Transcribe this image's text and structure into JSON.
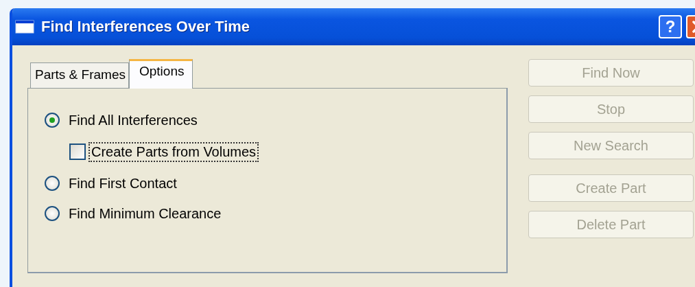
{
  "window": {
    "title": "Find Interferences Over Time",
    "help": "?"
  },
  "tabs": [
    {
      "label": "Parts & Frames",
      "selected": false
    },
    {
      "label": "Options",
      "selected": true
    }
  ],
  "options": [
    {
      "kind": "radio",
      "label": "Find All Interferences",
      "checked": true,
      "focused": false
    },
    {
      "kind": "checkbox",
      "label": "Create Parts from Volumes",
      "checked": false,
      "focused": true
    },
    {
      "kind": "radio",
      "label": "Find First Contact",
      "checked": false,
      "focused": false
    },
    {
      "kind": "radio",
      "label": "Find Minimum Clearance",
      "checked": false,
      "focused": false
    }
  ],
  "button_groups": [
    [
      {
        "label": "Find Now",
        "disabled": true
      },
      {
        "label": "Stop",
        "disabled": true
      },
      {
        "label": "New Search",
        "disabled": true
      }
    ],
    [
      {
        "label": "Create Part",
        "disabled": true
      },
      {
        "label": "Delete Part",
        "disabled": true
      }
    ]
  ]
}
